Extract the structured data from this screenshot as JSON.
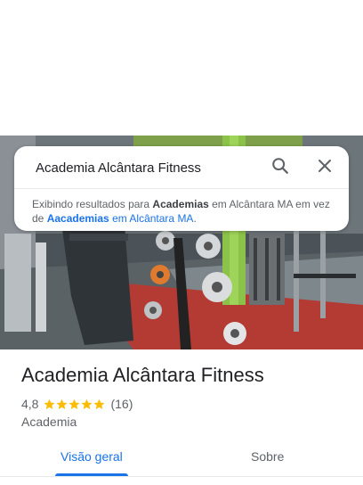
{
  "search": {
    "query": "Academia Alcântara Fitness",
    "suggestion": {
      "prefix": "Exibindo resultados para ",
      "term_shown": "Academias",
      "middle": " em Alcântara MA em vez de ",
      "term_original": "Aacademias",
      "suffix": " em Alcântara MA",
      "end": "."
    }
  },
  "place": {
    "name": "Academia Alcântara Fitness",
    "rating": "4,8",
    "rating_value": 4.8,
    "stars_max": 5,
    "reviews": "(16)",
    "category": "Academia"
  },
  "tabs": [
    {
      "label": "Visão geral",
      "active": true
    },
    {
      "label": "Sobre",
      "active": false
    }
  ],
  "icons": {
    "search": "search-icon",
    "close": "close-icon",
    "star": "star-icon"
  },
  "colors": {
    "accent": "#1a73e8",
    "star": "#fbbc04",
    "text_secondary": "#5f6368"
  }
}
